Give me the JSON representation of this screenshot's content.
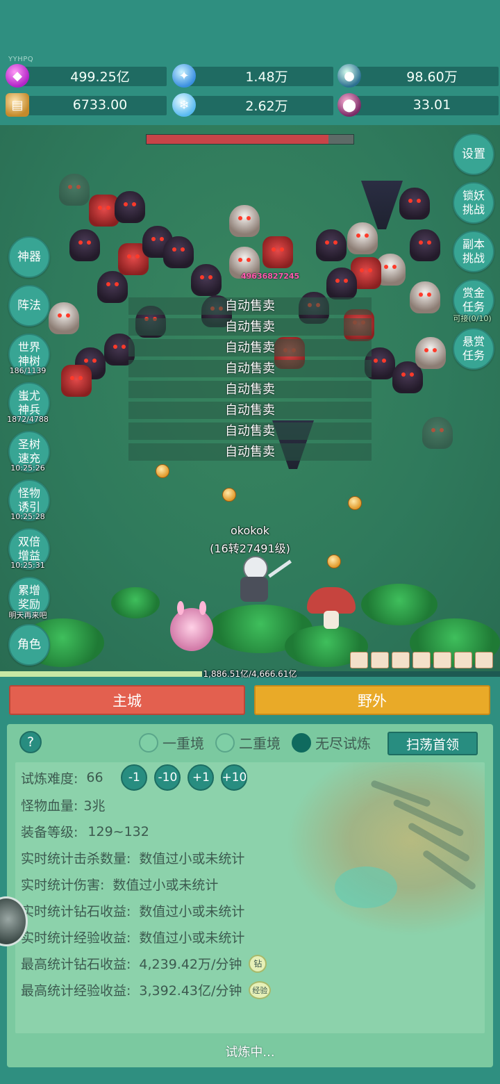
{
  "top": {
    "small_label": "YYHPQ",
    "resources": [
      {
        "icon": "gem-icon",
        "value": "499.25亿",
        "color": "#c33ad8"
      },
      {
        "icon": "crystal-icon",
        "value": "1.48万",
        "color": "#3a8fe0"
      },
      {
        "icon": "orb-icon",
        "value": "98.60万",
        "color": "#2b6f90"
      },
      {
        "icon": "book-icon",
        "value": "6733.00",
        "color": "#c58a2b"
      },
      {
        "icon": "ice-icon",
        "value": "2.62万",
        "color": "#58b9f0"
      },
      {
        "icon": "potion-icon",
        "value": "33.01",
        "color": "#7a2a66"
      }
    ]
  },
  "battle": {
    "boss_hp_fraction": 0.88,
    "damage_number": "49636827245",
    "auto_sell": [
      "自动售卖",
      "自动售卖",
      "自动售卖",
      "自动售卖",
      "自动售卖",
      "自动售卖",
      "自动售卖",
      "自动售卖"
    ],
    "player_name": "okokok",
    "player_level": "(16转27491级)",
    "xp_text": "1,886.51亿/4,666.61亿",
    "xp_fraction": 0.404
  },
  "left_buttons": [
    {
      "label": "神器",
      "sub": ""
    },
    {
      "label": "阵法",
      "sub": ""
    },
    {
      "label": "世界神树",
      "sub": "186/1139"
    },
    {
      "label": "蚩尤神兵",
      "sub": "1872/4788"
    },
    {
      "label": "圣树速充",
      "sub": "10:25:26"
    },
    {
      "label": "怪物诱引",
      "sub": "10:25:28"
    },
    {
      "label": "双倍增益",
      "sub": "10:25:31"
    },
    {
      "label": "累增奖励",
      "sub": "明天再来吧"
    },
    {
      "label": "角色",
      "sub": ""
    }
  ],
  "right_buttons": [
    {
      "label": "设置",
      "sub": ""
    },
    {
      "label": "锁妖挑战",
      "sub": ""
    },
    {
      "label": "副本挑战",
      "sub": ""
    },
    {
      "label": "赏金任务",
      "sub": "可接(0/10)"
    },
    {
      "label": "悬赏任务",
      "sub": ""
    }
  ],
  "tabs": {
    "city": "主城",
    "wild": "野外"
  },
  "panel": {
    "help": "?",
    "modes": [
      {
        "label": "一重境",
        "selected": false
      },
      {
        "label": "二重境",
        "selected": false
      },
      {
        "label": "无尽试炼",
        "selected": true
      }
    ],
    "sweep_button": "扫荡首领",
    "difficulty_label": "试炼难度:",
    "difficulty_value": "66",
    "steps": [
      "-1",
      "-10",
      "+1",
      "+10"
    ],
    "stats": [
      {
        "key": "怪物血量:",
        "value": "3兆"
      },
      {
        "key": "装备等级:",
        "value": "129~132"
      },
      {
        "key": "实时统计击杀数量:",
        "value": "数值过小或未统计"
      },
      {
        "key": "实时统计伤害:",
        "value": "数值过小或未统计"
      },
      {
        "key": "实时统计钻石收益:",
        "value": "数值过小或未统计"
      },
      {
        "key": "实时统计经验收益:",
        "value": "数值过小或未统计"
      },
      {
        "key": "最高统计钻石收益:",
        "value": "4,239.42万/分钟",
        "badge": "钻"
      },
      {
        "key": "最高统计经验收益:",
        "value": "3,392.43亿/分钟",
        "badge": "经验"
      }
    ],
    "status": "试炼中..."
  }
}
